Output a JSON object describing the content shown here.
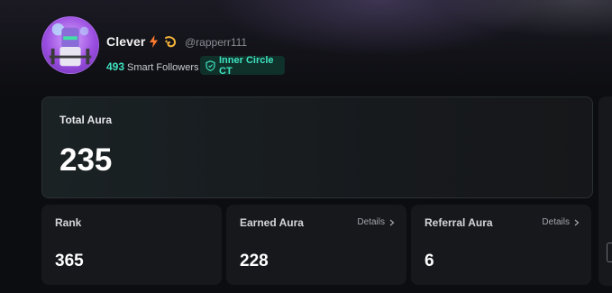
{
  "profile": {
    "display_name": "Clever",
    "handle": "@rapperr111",
    "followers_count": "493",
    "followers_label": "Smart Followers",
    "badge_label": "Inner Circle CT"
  },
  "total_aura": {
    "label": "Total Aura",
    "value": "235"
  },
  "stats": {
    "rank": {
      "label": "Rank",
      "value": "365"
    },
    "earned": {
      "label": "Earned Aura",
      "value": "228",
      "details_label": "Details"
    },
    "referral": {
      "label": "Referral Aura",
      "value": "6",
      "details_label": "Details"
    }
  },
  "colors": {
    "accent": "#3fe3c0",
    "badge_bg": "#10302a",
    "bolt": "#ff7a2e",
    "swirl": "#f5b53a"
  },
  "icons": [
    "lightning-icon",
    "swirl-icon",
    "shield-icon",
    "chevron-right-icon"
  ]
}
